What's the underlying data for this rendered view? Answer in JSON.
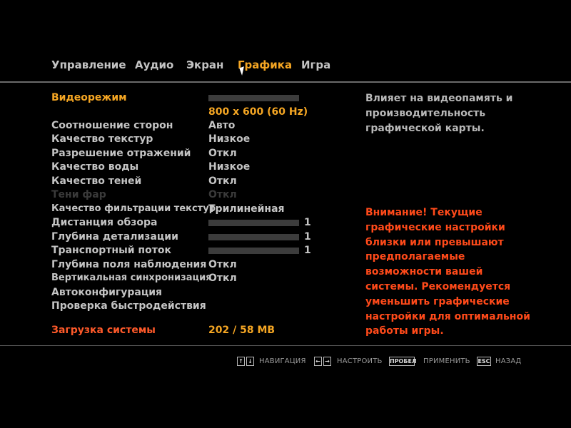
{
  "tabs": [
    {
      "label": "Управление",
      "active": false
    },
    {
      "label": "Аудио",
      "active": false
    },
    {
      "label": "Экран",
      "active": false
    },
    {
      "label": "Графика",
      "active": true
    },
    {
      "label": "Игра",
      "active": false
    }
  ],
  "settings": {
    "video_mode": {
      "label": "Видеорежим",
      "value": "800 x 600 (60 Hz)",
      "level": 0
    },
    "aspect_ratio": {
      "label": "Соотношение сторон",
      "value": "Авто"
    },
    "texture_quality": {
      "label": "Качество текстур",
      "value": "Низкое"
    },
    "reflection_resolution": {
      "label": "Разрешение отражений",
      "value": "Откл"
    },
    "water_quality": {
      "label": "Качество воды",
      "value": "Низкое"
    },
    "shadow_quality": {
      "label": "Качество теней",
      "value": "Откл"
    },
    "headlight_shadows": {
      "label": "Тени фар",
      "value": "Откл",
      "disabled": true
    },
    "texture_filtering": {
      "label": "Качество фильтрации текстур",
      "value": "Трилинейная"
    },
    "view_distance": {
      "label": "Дистанция обзора",
      "value": "1",
      "level": 0
    },
    "detail_distance": {
      "label": "Глубина детализации",
      "value": "1",
      "level": 0
    },
    "vehicle_density": {
      "label": "Транспортный поток",
      "value": "1",
      "level": 0
    },
    "depth_of_field": {
      "label": "Глубина поля наблюдения",
      "value": "Откл"
    },
    "vsync": {
      "label": "Вертикальная синхронизация",
      "value": "Откл"
    },
    "auto_config": {
      "label": "Автоконфигурация"
    },
    "benchmark": {
      "label": "Проверка быстродействия"
    },
    "system_load": {
      "label": "Загрузка системы",
      "value": "202 / 58 MB"
    }
  },
  "description": "Влияет на видеопамять и производительность графической карты.",
  "warning": "Внимание! Текущие графические настройки близки или превышают предполагаемые возможности вашей системы. Рекомендуется уменьшить графические настройки для оптимальной работы игры.",
  "footer": {
    "nav_keys": [
      "↑",
      "↓"
    ],
    "nav_label": "НАВИГАЦИЯ",
    "adjust_keys": [
      "←",
      "→"
    ],
    "adjust_label": "НАСТРОИТЬ",
    "apply_key": "ПРОБЕЛ",
    "apply_label": "ПРИМЕНИТЬ",
    "back_key": "ESC",
    "back_label": "НАЗАД"
  },
  "colors": {
    "accent": "#f5a623",
    "warning": "#ff4a1a",
    "text": "#c4c4c4",
    "disabled": "#3a3a3a",
    "background": "#000000"
  }
}
